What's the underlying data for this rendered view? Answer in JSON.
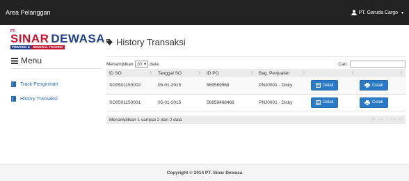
{
  "navbar": {
    "brand": "Area Pelanggan",
    "user": "PT. Garuda Cargo",
    "caret": "▾"
  },
  "logo": {
    "pt": "PT.",
    "sinar": "SINAR",
    "dewasa": "DEWASA",
    "sub_a": "PRINTING &",
    "sub_b": "GENERAL TRADING"
  },
  "sidebar": {
    "title": "Menu",
    "items": [
      {
        "label": "Track Pengiriman",
        "icon": "book-icon"
      },
      {
        "label": "History Transaksi",
        "icon": "book-icon"
      }
    ]
  },
  "page": {
    "title": "History Transaksi"
  },
  "table_controls": {
    "show_prefix": "Menampilkan",
    "length_value": "10",
    "show_suffix": "data",
    "search_label": "Cari:",
    "search_value": ""
  },
  "table": {
    "headers": [
      "ID SO",
      "Tanggal SO",
      "ID PO",
      "Bag. Penjualan",
      "",
      ""
    ],
    "rows": [
      {
        "id_so": "SO0501150002",
        "tanggal": "05-01-2015",
        "id_po": "569569568",
        "bag": "PNJ0001 - Dicky",
        "detail": "Detail",
        "cetak": "Cetak"
      },
      {
        "id_so": "SO0501150001",
        "tanggal": "05-01-2015",
        "id_po": "56858468468",
        "bag": "PNJ0001 - Dicky",
        "detail": "Detail",
        "cetak": "Cetak"
      }
    ],
    "info": "Menampilkan 1 sampai 2 dari 2 data",
    "pager": "|< << 1 >> >|"
  },
  "footer": {
    "text": "Copyright © 2014 PT. Sinar Dewasa"
  },
  "colors": {
    "navbar": "#222222",
    "accent": "#2a7ac7",
    "logo_red": "#c8102e",
    "logo_blue": "#1f3f8a"
  }
}
